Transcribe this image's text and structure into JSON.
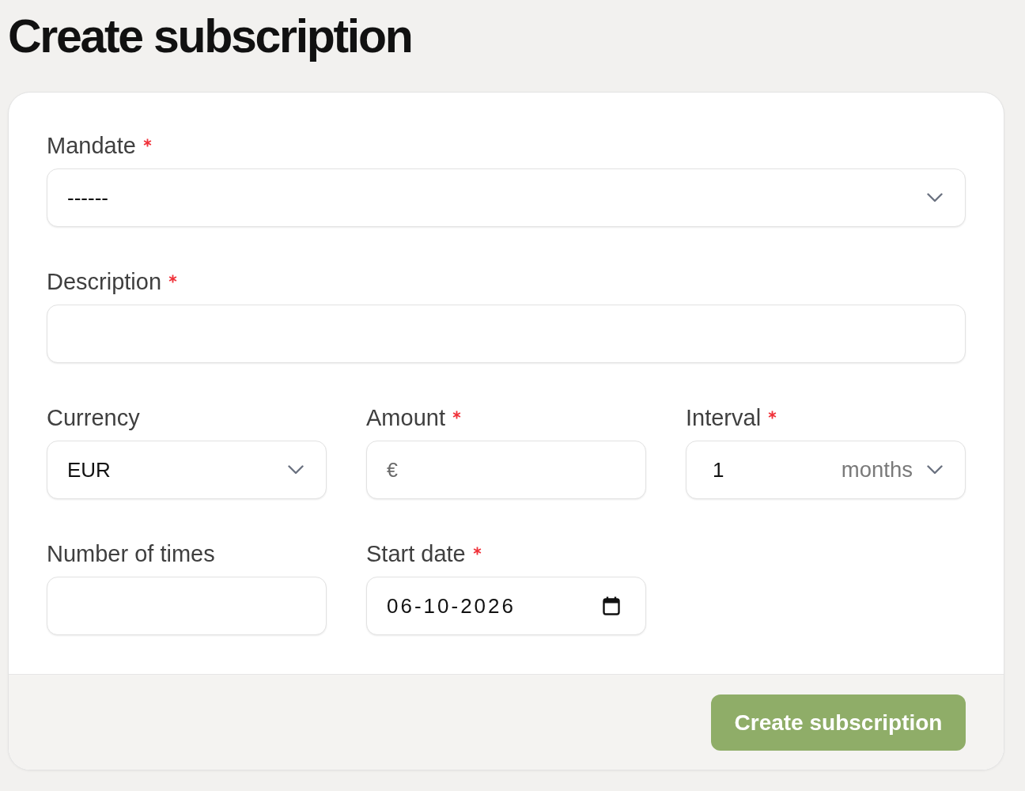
{
  "page": {
    "title": "Create subscription"
  },
  "form": {
    "rows": [
      {
        "fields": [
          {
            "kind": "select",
            "label": "Mandate",
            "required": true,
            "value": "------"
          }
        ]
      },
      {
        "fields": [
          {
            "kind": "text",
            "label": "Description",
            "required": true
          }
        ]
      },
      {
        "fields": [
          {
            "kind": "select",
            "label": "Currency",
            "required": false,
            "value": "EUR"
          },
          {
            "kind": "text",
            "label": "Amount",
            "required": true,
            "prefix": "€"
          },
          {
            "kind": "interval",
            "label": "Interval",
            "required": true,
            "value": "1",
            "unit": "months"
          }
        ]
      },
      {
        "fields": [
          {
            "kind": "text",
            "label": "Number of times",
            "required": false
          },
          {
            "kind": "date",
            "label": "Start date",
            "required": true,
            "value": "06-10-2026"
          }
        ]
      }
    ]
  },
  "submit_button": {
    "label": "Create subscription"
  }
}
